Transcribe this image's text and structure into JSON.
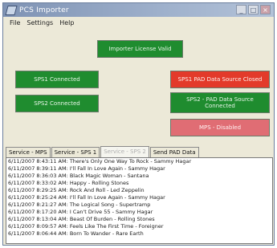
{
  "window": {
    "title": "PCS Importer",
    "controls": {
      "minimize": "_",
      "maximize": "□",
      "close": "×"
    }
  },
  "menu": [
    "File",
    "Settings",
    "Help"
  ],
  "status": {
    "license": "Importer License Valid",
    "sps1_connection": "SPS1 Connected",
    "sps2_connection": "SPS2 Connected",
    "sps1_pad": "SPS1 PAD Data Source Closed",
    "sps2_pad": "SPS2 - PAD Data Source Connected",
    "mps": "MPS - Disabled"
  },
  "colors": {
    "connected": "#1f8c2f",
    "closed": "#e33a2a",
    "disabled": "#e06d74"
  },
  "tabs": [
    "Service - MPS",
    "Service - SPS 1",
    "Service - SPS 2",
    "Send PAD Data"
  ],
  "active_tab": "Service - SPS 2",
  "log": [
    "6/11/2007 8:43:11 AM: There's Only One Way To Rock - Sammy Hagar",
    "6/11/2007 8:39:11 AM: I'll Fall In Love Again - Sammy Hagar",
    "6/11/2007 8:36:03 AM: Black Magic Woman - Santana",
    "6/11/2007 8:33:02 AM: Happy - Rolling Stones",
    "6/11/2007 8:29:25 AM: Rock And Roll - Led Zeppelin",
    "6/11/2007 8:25:24 AM: I'll Fall In Love Again - Sammy Hagar",
    "6/11/2007 8:21:27 AM: The Logical Song - Supertramp",
    "6/11/2007 8:17:20 AM: I Can't Drive 55 - Sammy Hagar",
    "6/11/2007 8:13:04 AM: Beast Of Burden - Rolling Stones",
    "6/11/2007 8:09:57 AM: Feels Like The First Time - Foreigner",
    "6/11/2007 8:06:44 AM: Born To Wander - Rare Earth"
  ]
}
